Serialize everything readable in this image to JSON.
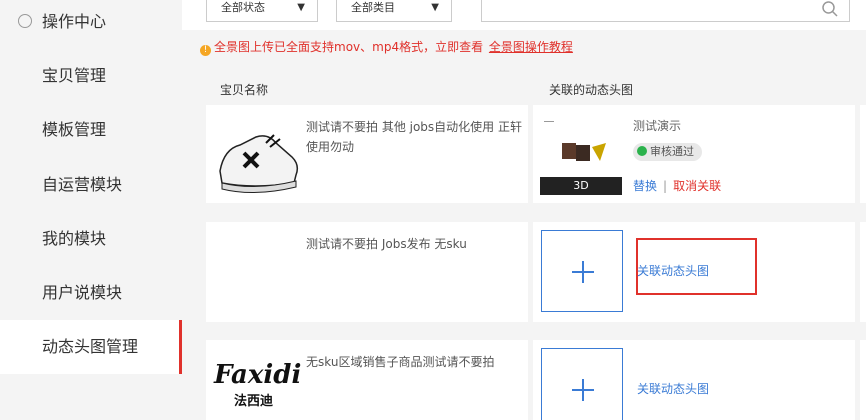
{
  "sidebar": {
    "items": [
      {
        "label": "操作中心",
        "icon": "gear-icon"
      },
      {
        "label": "宝贝管理"
      },
      {
        "label": "模板管理"
      },
      {
        "label": "自运营模块"
      },
      {
        "label": "我的模块"
      },
      {
        "label": "用户说模块"
      },
      {
        "label": "动态头图管理",
        "active": true
      }
    ]
  },
  "toolbar": {
    "status_select": "全部状态",
    "category_select": "全部类目",
    "search_placeholder": ""
  },
  "notice": {
    "text": "全景图上传已全面支持mov、mp4格式，立即查看",
    "link": "全景图操作教程"
  },
  "table": {
    "headers": [
      "宝贝名称",
      "关联的动态头图"
    ],
    "rows": [
      {
        "product_name": "测试请不要拍 其他 jobs自动化使用 正轩使用勿动",
        "dynamic": {
          "title": "测试演示",
          "badge": "审核通过",
          "tag": "3D",
          "replace_label": "替换",
          "separator": "|",
          "cancel_label": "取消关联"
        }
      },
      {
        "product_name": "测试请不要拍 Jobs发布 无sku",
        "associate_label": "关联动态头图"
      },
      {
        "product_name": "无sku区域销售子商品测试请不要拍",
        "logo_text": "Faxidi",
        "logo_sub": "法西迪",
        "associate_label": "关联动态头图"
      }
    ]
  },
  "colors": {
    "accent_red": "#e0312b",
    "link_blue": "#3a7bd5",
    "approved_green": "#2bb24c"
  }
}
